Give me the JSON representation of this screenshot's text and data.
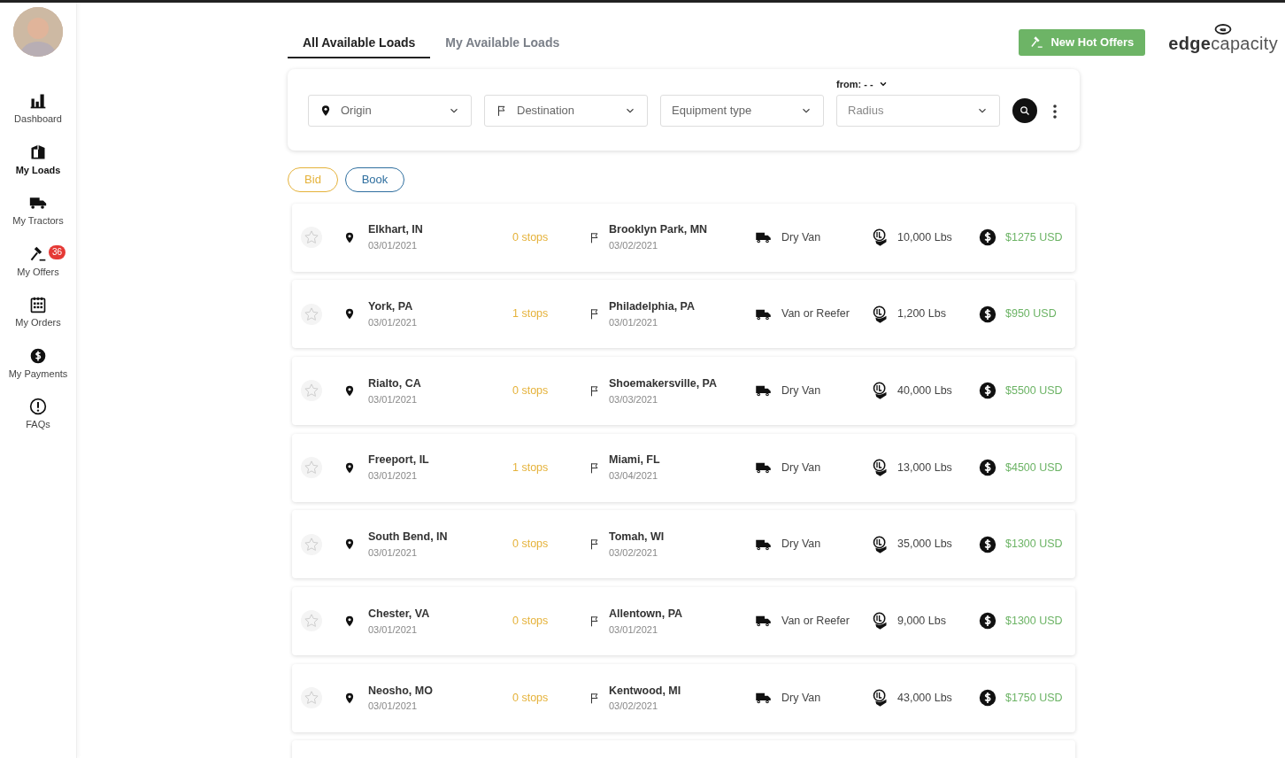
{
  "sidebar": {
    "items": [
      {
        "label": "Dashboard",
        "kind": "dashboard",
        "selected": false
      },
      {
        "label": "My Loads",
        "kind": "loads",
        "selected": true
      },
      {
        "label": "My Tractors",
        "kind": "tractors",
        "selected": false
      },
      {
        "label": "My Offers",
        "kind": "offers",
        "selected": false,
        "badge": "36"
      },
      {
        "label": "My Orders",
        "kind": "orders",
        "selected": false
      },
      {
        "label": "My Payments",
        "kind": "payments",
        "selected": false
      },
      {
        "label": "FAQs",
        "kind": "faqs",
        "selected": false
      }
    ]
  },
  "tabs": [
    {
      "label": "All Available Loads",
      "selected": true
    },
    {
      "label": "My Available Loads",
      "selected": false
    }
  ],
  "hot_offers_button": "New Hot Offers",
  "logo": {
    "bold": "edge",
    "light": "capacity"
  },
  "filters": {
    "from_label": "from: - -",
    "fields": [
      {
        "kind": "origin",
        "placeholder": "Origin"
      },
      {
        "kind": "destination",
        "placeholder": "Destination"
      },
      {
        "kind": "equipment",
        "placeholder": "Equipment type"
      },
      {
        "kind": "radius",
        "placeholder": "Radius"
      }
    ]
  },
  "mode_buttons": [
    {
      "label": "Bid",
      "kind": "bid"
    },
    {
      "label": "Book",
      "kind": "book"
    }
  ],
  "loads": [
    {
      "starred": false,
      "origin": "Elkhart, IN",
      "origin_date": "03/01/2021",
      "stops": "0 stops",
      "destination": "Brooklyn Park, MN",
      "destination_date": "03/02/2021",
      "equipment": "Dry Van",
      "weight": "10,000 Lbs",
      "price": "$1275 USD"
    },
    {
      "starred": false,
      "origin": "York, PA",
      "origin_date": "03/01/2021",
      "stops": "1 stops",
      "destination": "Philadelphia, PA",
      "destination_date": "03/01/2021",
      "equipment": "Van or Reefer",
      "weight": "1,200 Lbs",
      "price": "$950 USD"
    },
    {
      "starred": false,
      "origin": "Rialto, CA",
      "origin_date": "03/01/2021",
      "stops": "0 stops",
      "destination": "Shoemakersville, PA",
      "destination_date": "03/03/2021",
      "equipment": "Dry Van",
      "weight": "40,000 Lbs",
      "price": "$5500 USD"
    },
    {
      "starred": false,
      "origin": "Freeport, IL",
      "origin_date": "03/01/2021",
      "stops": "1 stops",
      "destination": "Miami, FL",
      "destination_date": "03/04/2021",
      "equipment": "Dry Van",
      "weight": "13,000 Lbs",
      "price": "$4500 USD"
    },
    {
      "starred": false,
      "origin": "South Bend, IN",
      "origin_date": "03/01/2021",
      "stops": "0 stops",
      "destination": "Tomah, WI",
      "destination_date": "03/02/2021",
      "equipment": "Dry Van",
      "weight": "35,000 Lbs",
      "price": "$1300 USD"
    },
    {
      "starred": false,
      "origin": "Chester, VA",
      "origin_date": "03/01/2021",
      "stops": "0 stops",
      "destination": "Allentown, PA",
      "destination_date": "03/01/2021",
      "equipment": "Van or Reefer",
      "weight": "9,000 Lbs",
      "price": "$1300 USD"
    },
    {
      "starred": false,
      "origin": "Neosho, MO",
      "origin_date": "03/01/2021",
      "stops": "0 stops",
      "destination": "Kentwood, MI",
      "destination_date": "03/02/2021",
      "equipment": "Dry Van",
      "weight": "43,000 Lbs",
      "price": "$1750 USD"
    }
  ]
}
